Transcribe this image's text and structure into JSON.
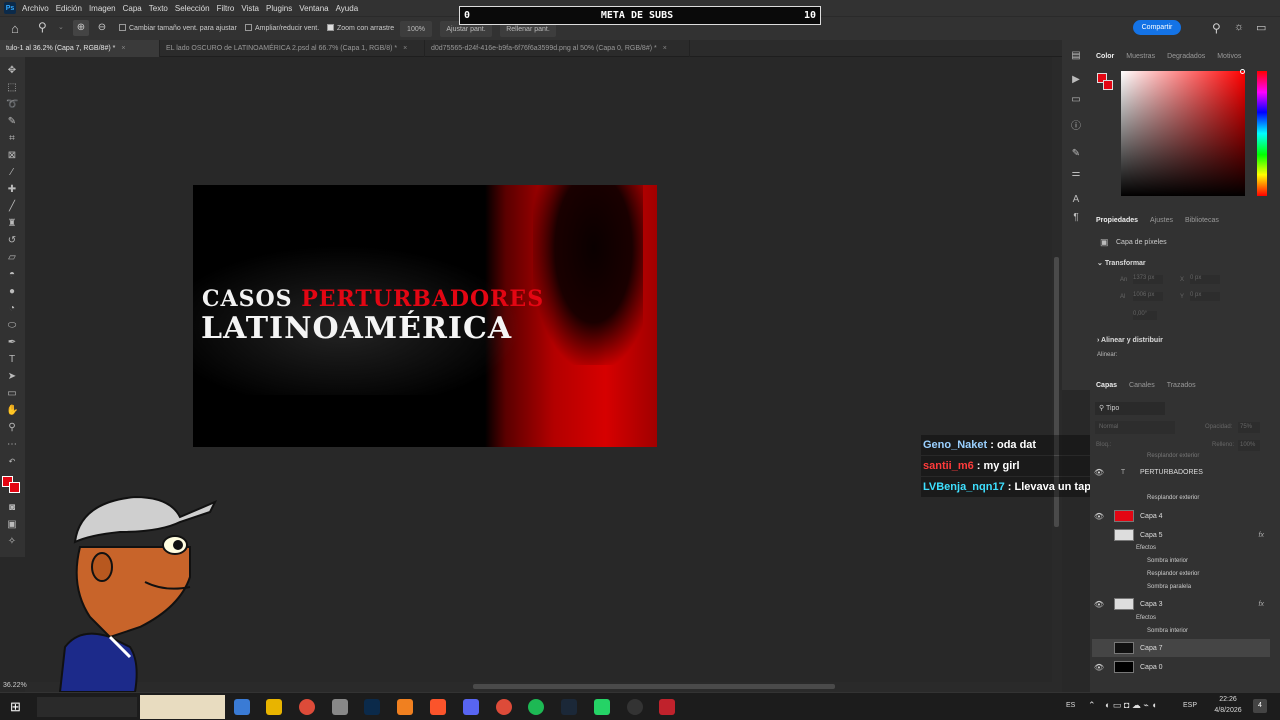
{
  "app": {
    "logo": "Ps"
  },
  "menu": [
    "Archivo",
    "Edición",
    "Imagen",
    "Capa",
    "Texto",
    "Selección",
    "Filtro",
    "Vista",
    "Plugins",
    "Ventana",
    "Ayuda"
  ],
  "options": {
    "resize_windows": "Cambiar tamaño vent. para ajustar",
    "zoom_all": "Ampliar/reducir vent.",
    "scrubby_zoom": "Zoom con arrastre",
    "zoom_level": "100%",
    "fit_screen": "Ajustar pant.",
    "fill_screen": "Rellenar pant."
  },
  "sub_goal": {
    "current": "0",
    "label": "META DE SUBS",
    "target": "10"
  },
  "share_label": "Compartir",
  "tabs": [
    {
      "label": "tulo-1 al 36.2% (Capa 7, RGB/8#) *",
      "active": true
    },
    {
      "label": "EL lado OSCURO de LATINOAMÉRICA 2.psd al 66.7% (Capa 1, RGB/8) *",
      "active": false
    },
    {
      "label": "d0d75565-d24f-416e-b9fa-6f76f6a3599d.png al 50% (Capa 0, RGB/8#) *",
      "active": false
    }
  ],
  "thumbnail": {
    "line1_white": "CASOS ",
    "line1_red": "PERTURBADORES",
    "line2": "LATINOAMÉRICA"
  },
  "chat": [
    {
      "user": "Geno_Naket",
      "color": "#9ad0ff",
      "msg": " : oda dat"
    },
    {
      "user": "santii_m6",
      "color": "#ff3b3b",
      "msg": " : my girl"
    },
    {
      "user": "LVBenja_nqn17",
      "color": "#3ee0ff",
      "msg": " : Llevava un taper mas grande que una caja xddd"
    }
  ],
  "status": {
    "zoom": "36.22%"
  },
  "color_panel": {
    "tabs": [
      "Color",
      "Muestras",
      "Degradados",
      "Motivos"
    ],
    "fg": "#e30613",
    "bg": "#e30613"
  },
  "properties": {
    "tabs": [
      "Propiedades",
      "Ajustes",
      "Bibliotecas"
    ],
    "kind": "Capa de píxeles",
    "transform": "Transformar",
    "an": "An",
    "al": "Al",
    "x": "X",
    "y": "Y",
    "w_val": "1373 px",
    "h_val": "1006 px",
    "x_val": "0 px",
    "y_val": "0 px",
    "angle": "0,00°",
    "align": "Alinear y distribuir",
    "align_label": "Alinear:"
  },
  "layers_panel": {
    "tabs": [
      "Capas",
      "Canales",
      "Trazados"
    ],
    "filter": "Tipo",
    "blend": "Normal",
    "opacity_label": "Opacidad:",
    "opacity": "75%",
    "lock_label": "Bloq.:",
    "fill_label": "Relleno:",
    "fill": "100%"
  },
  "layers": [
    {
      "name": "Resplandor exterior",
      "type": "sub"
    },
    {
      "name": "PERTURBADORES",
      "type": "text"
    },
    {
      "name": "Resplandor exterior",
      "type": "sub"
    },
    {
      "name": "Capa 4",
      "type": "layer",
      "thumb": "red"
    },
    {
      "name": "Capa 5",
      "type": "layer",
      "thumb": "checker",
      "fx": true
    },
    {
      "name": "Efectos",
      "type": "sub"
    },
    {
      "name": "Sombra interior",
      "type": "sub"
    },
    {
      "name": "Resplandor exterior",
      "type": "sub"
    },
    {
      "name": "Sombra paralela",
      "type": "sub"
    },
    {
      "name": "Capa 3",
      "type": "layer",
      "thumb": "checker",
      "fx": true
    },
    {
      "name": "Efectos",
      "type": "sub"
    },
    {
      "name": "Sombra interior",
      "type": "sub"
    },
    {
      "name": "Capa 7",
      "type": "layer",
      "thumb": "photo",
      "selected": true
    },
    {
      "name": "Capa 0",
      "type": "layer",
      "thumb": "black"
    }
  ],
  "taskbar": {
    "lang1": "ES",
    "lang2": "ESP",
    "time": "22:26",
    "date": "4/8/2026",
    "notif": "4"
  }
}
